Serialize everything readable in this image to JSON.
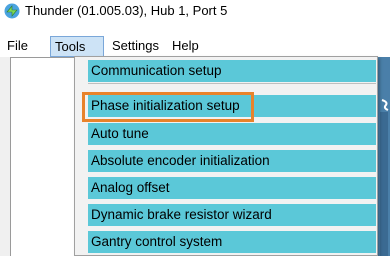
{
  "window": {
    "title": "Thunder (01.005.03), Hub 1, Port 5",
    "icon": "thunder-app-icon"
  },
  "menubar": {
    "file": "File",
    "tools": "Tools",
    "settings": "Settings",
    "help": "Help",
    "active": "Tools"
  },
  "tools_menu": {
    "items": [
      "Communication setup",
      "Phase initialization setup",
      "Auto tune",
      "Absolute encoder initialization",
      "Analog offset",
      "Dynamic brake resistor wizard",
      "Gantry control system"
    ],
    "highlighted_item": "Phase initialization setup"
  },
  "colors": {
    "menu_item_bg": "#5bc8d8",
    "highlight_border": "#e8832b",
    "active_menu_bg": "#cde3f6"
  }
}
